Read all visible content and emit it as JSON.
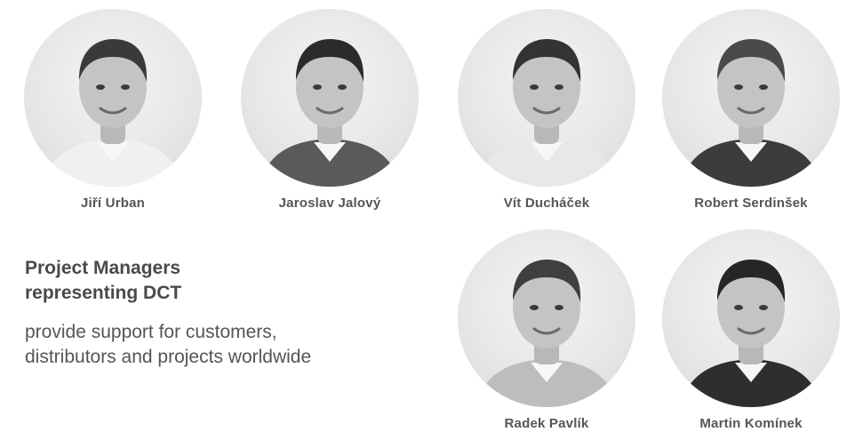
{
  "team": [
    {
      "name": "Jiří Urban",
      "photo_icon": "portrait-photo",
      "suit": "#f0f0f0",
      "hair": "#3a3a3a"
    },
    {
      "name": "Jaroslav Jalový",
      "photo_icon": "portrait-photo",
      "suit": "#5a5a5a",
      "hair": "#2b2b2b"
    },
    {
      "name": "Vít Ducháček",
      "photo_icon": "portrait-photo",
      "suit": "#e8e8e8",
      "hair": "#333333"
    },
    {
      "name": "Robert Serdinšek",
      "photo_icon": "portrait-photo",
      "suit": "#3c3c3c",
      "hair": "#4a4a4a"
    },
    {
      "name": "Radek Pavlík",
      "photo_icon": "portrait-photo",
      "suit": "#bdbdbd",
      "hair": "#3f3f3f"
    },
    {
      "name": "Martin Komínek",
      "photo_icon": "portrait-photo",
      "suit": "#2e2e2e",
      "hair": "#262626"
    }
  ],
  "intro": {
    "title_line1": "Project Managers",
    "title_line2": "representing DCT",
    "text": "provide support for customers, distributors and projects worldwide"
  }
}
